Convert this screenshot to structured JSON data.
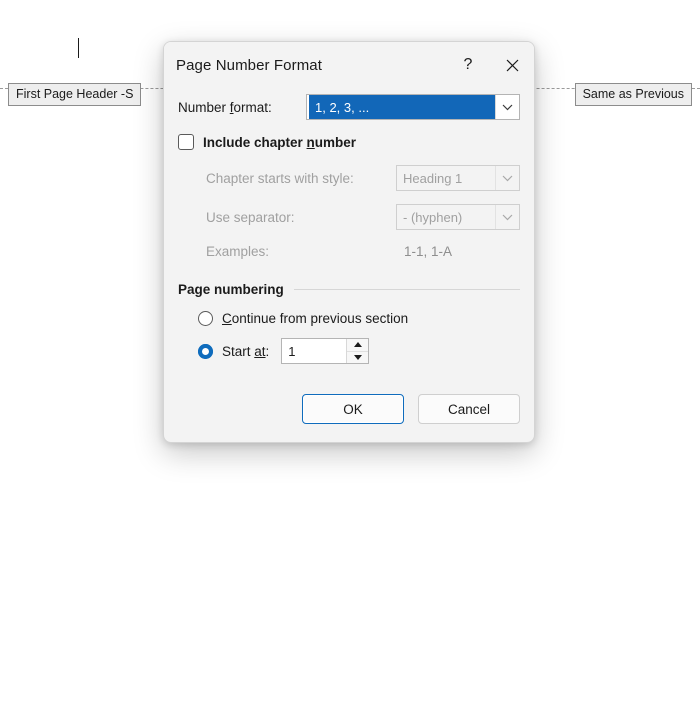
{
  "background": {
    "header_tags": [
      {
        "name": "first-page-header",
        "label": "First Page Header -S"
      },
      {
        "name": "same-as-previous",
        "label": "Same as Previous"
      }
    ]
  },
  "dialog": {
    "title": "Page Number Format",
    "help_icon": "?",
    "close_icon": "close-icon",
    "number_format": {
      "label_prefix": "Number ",
      "label_accel": "f",
      "label_suffix": "ormat:",
      "value": "1, 2, 3, ...",
      "selected": true,
      "highlight_color": "#1267b8"
    },
    "include_chapter": {
      "label_prefix": "Include chapter ",
      "label_accel": "n",
      "label_suffix": "umber",
      "checked": false
    },
    "chapter_style": {
      "label": "Chapter starts with style:",
      "value": "Heading 1",
      "enabled": false
    },
    "separator": {
      "label": "Use separator:",
      "value": "-   (hyphen)",
      "enabled": false
    },
    "examples": {
      "label": "Examples:",
      "value": "1-1, 1-A",
      "enabled": false
    },
    "page_numbering": {
      "group_label": "Page numbering",
      "continue_option": {
        "label_accel": "C",
        "label_suffix": "ontinue from previous section",
        "selected": false
      },
      "start_at_option": {
        "label_prefix": "Start ",
        "label_accel": "at",
        "label_suffix": ":",
        "selected": true,
        "value": "1",
        "increment_icon": "triangle-up-icon",
        "decrement_icon": "triangle-down-icon"
      }
    },
    "footer": {
      "ok_label": "OK",
      "cancel_label": "Cancel",
      "default_button": "OK",
      "accent_color": "#0f6cbd"
    }
  }
}
